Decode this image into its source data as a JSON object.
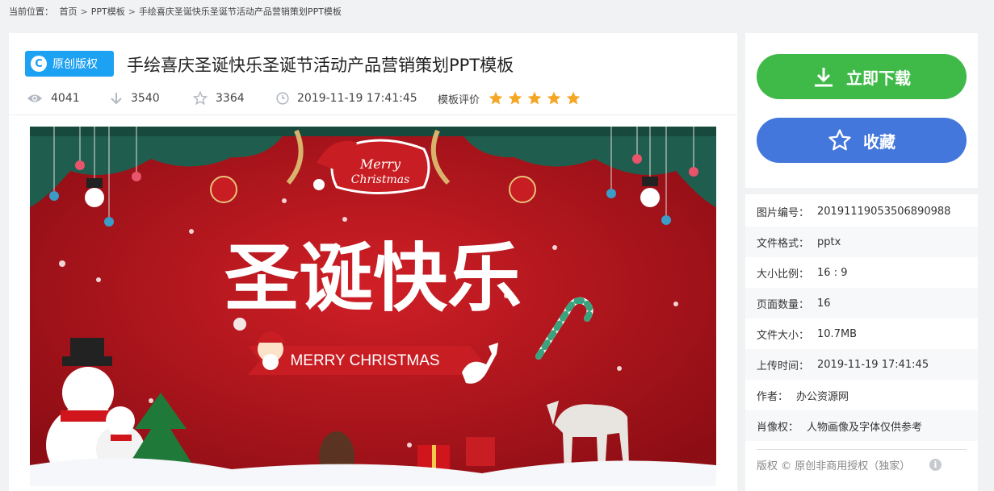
{
  "breadcrumb": {
    "prefix": "当前位置：",
    "items": [
      "首页",
      "PPT模板",
      "手绘喜庆圣诞快乐圣诞节活动产品营销策划PPT模板"
    ],
    "separator": ">"
  },
  "header": {
    "badge_label": "原创版权",
    "badge_icon": "copyright-c-icon",
    "title": "手绘喜庆圣诞快乐圣诞节活动产品营销策划PPT模板"
  },
  "stats": {
    "views": "4041",
    "downloads": "3540",
    "favorites": "3364",
    "upload_time": "2019-11-19 17:41:45",
    "rating_label": "模板评价",
    "rating_stars": 5
  },
  "preview": {
    "main_text": "圣诞快乐",
    "sub_text": "MERRY CHRISTMAS",
    "sign_text_1": "Merry",
    "sign_text_2": "Christmas"
  },
  "actions": {
    "download_label": "立即下载",
    "favorite_label": "收藏"
  },
  "info": {
    "rows": [
      {
        "key": "图片编号：",
        "value": "20191119053506890988"
      },
      {
        "key": "文件格式：",
        "value": "pptx"
      },
      {
        "key": "大小比例：",
        "value": "16 : 9"
      },
      {
        "key": "页面数量：",
        "value": "16"
      },
      {
        "key": "文件大小：",
        "value": "10.7MB"
      },
      {
        "key": "上传时间：",
        "value": "2019-11-19 17:41:45"
      },
      {
        "key": "作者：",
        "value": "办公资源网"
      },
      {
        "key": "肖像权：",
        "value": "人物画像及字体仅供参考"
      }
    ],
    "copyright": "版权 © 原创非商用授权（独家）"
  },
  "colors": {
    "accent_blue": "#1da1f2",
    "download_green": "#3fba49",
    "favorite_blue": "#4477db",
    "star_orange": "#f5a623"
  }
}
